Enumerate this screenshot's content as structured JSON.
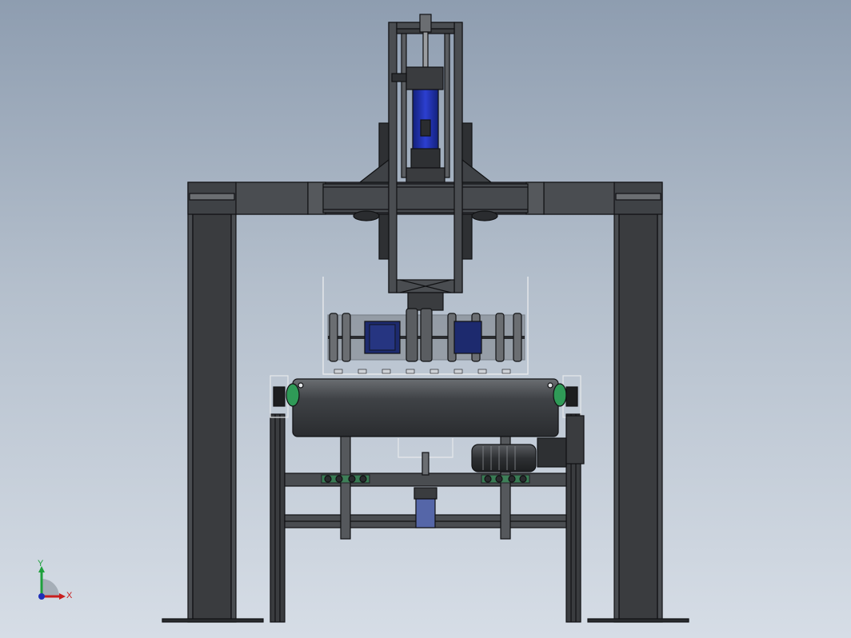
{
  "viewport": {
    "background_top": "#8e9db0",
    "background_bottom": "#d6dde6"
  },
  "model": {
    "frame_color": "#3a3c3f",
    "frame_face_color": "#4a4d51",
    "edge_color": "#111214",
    "cylinder_color": "#1e2f9e",
    "accent_green": "#2f9a57"
  },
  "triad": {
    "x_label": "X",
    "y_label": "Y",
    "x_color": "#c81e1e",
    "y_color": "#1ea03c",
    "origin_color": "#1e2fb8"
  }
}
